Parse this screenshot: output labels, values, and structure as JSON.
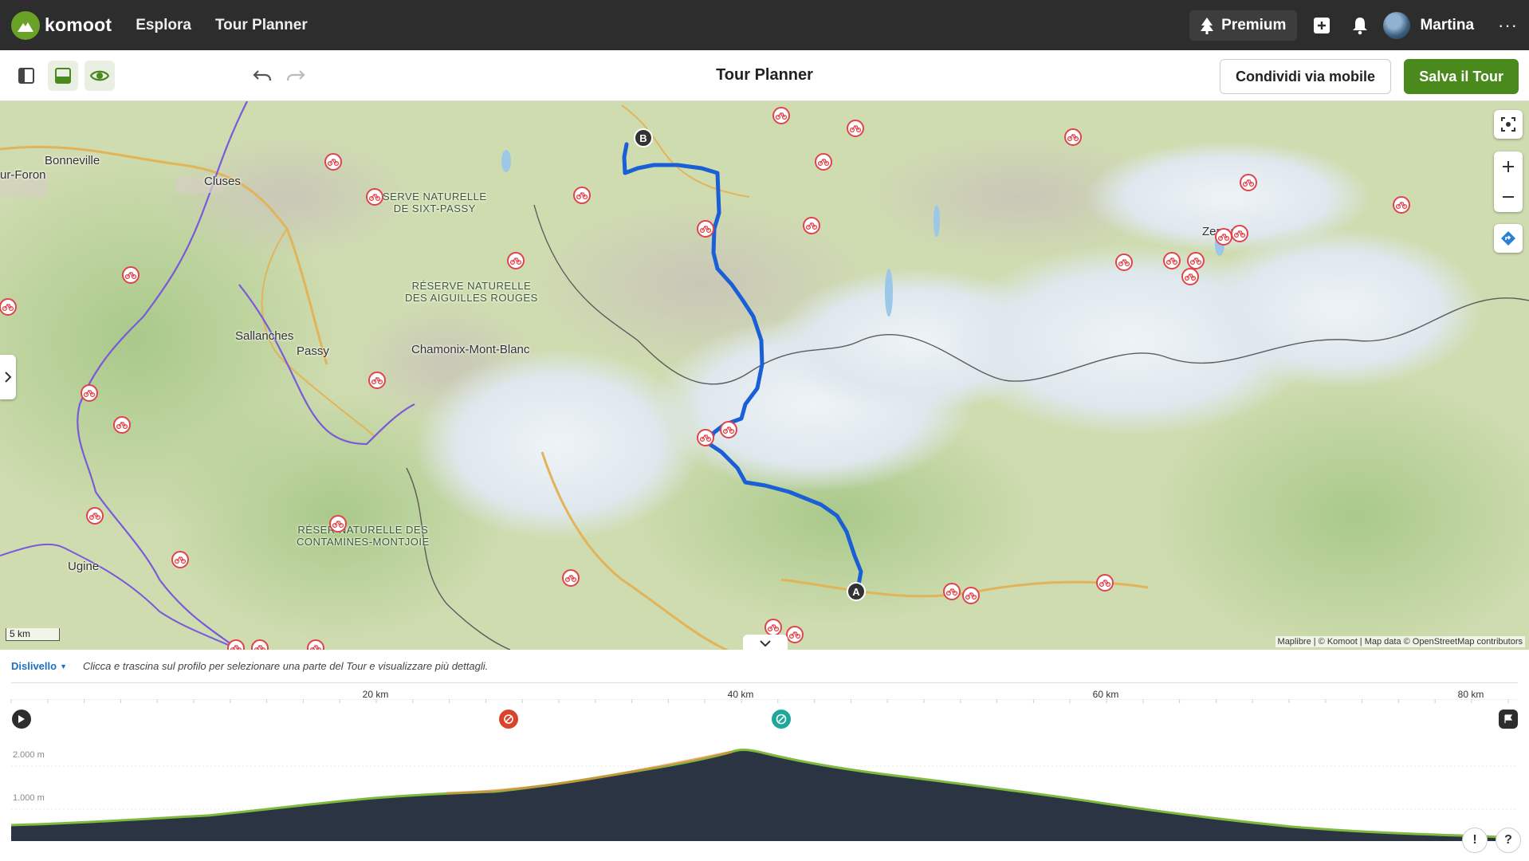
{
  "app": {
    "brand": "komoot"
  },
  "nav": {
    "explore": "Esplora",
    "tour_planner": "Tour Planner"
  },
  "header": {
    "premium": "Premium",
    "user_name": "Martina",
    "more": "···"
  },
  "toolbar": {
    "title": "Tour Planner",
    "share_label": "Condividi via mobile",
    "save_label": "Salva il Tour"
  },
  "map": {
    "places": [
      "Bonneville",
      "ur-Foron",
      "Cluses",
      "Sallanches",
      "Passy",
      "Chamonix-Mont-Blanc",
      "Ugine",
      "Zermatt"
    ],
    "reserves": [
      [
        "SERVE NATURELLE",
        "DE SIXT-PASSY"
      ],
      [
        "RÉSERVE NATURELLE",
        "DES AIGUILLES ROUGES"
      ],
      [
        "RÉSER  NATURELLE DES",
        "CONTAMINES-MONTJOIE"
      ]
    ],
    "start_marker": "A",
    "end_marker": "B",
    "scale": "5 km",
    "attribution": "Maplibre | © Komoot | Map data © OpenStreetMap contributors",
    "colors": {
      "route": "#1a5fd6",
      "border": "#7a5ad8",
      "poi": "#e0444a"
    }
  },
  "profile": {
    "metric": "Dislivello",
    "hint": "Clicca e trascina sul profilo per selezionare una parte del Tour e visualizzare più dettagli.",
    "km_ticks": [
      "20 km",
      "40 km",
      "60 km",
      "80 km"
    ],
    "alt_ticks": [
      "2.000 m",
      "1.000 m"
    ],
    "help_info": "!",
    "help_question": "?"
  }
}
